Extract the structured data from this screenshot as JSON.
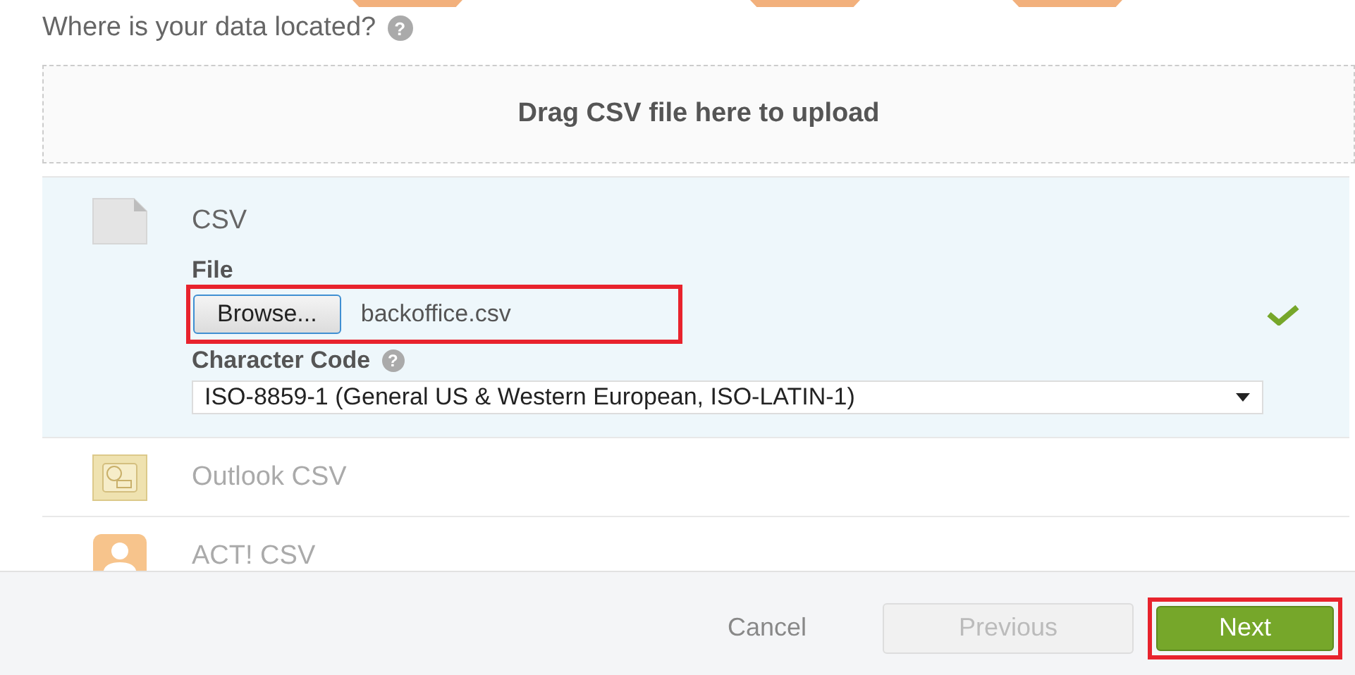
{
  "header": {
    "question": "Where is your data located?",
    "help": "?"
  },
  "dropzone": {
    "text": "Drag CSV file here to upload"
  },
  "sources": [
    {
      "kind": "csv",
      "label": "CSV",
      "selected": true,
      "file_label": "File",
      "browse": "Browse...",
      "filename": "backoffice.csv",
      "file_highlighted": true,
      "valid": true,
      "charset_label": "Character Code",
      "charset_help": "?",
      "charset": "ISO-8859-1 (General US & Western European, ISO-LATIN-1)"
    },
    {
      "kind": "outlook",
      "label": "Outlook CSV",
      "selected": false
    },
    {
      "kind": "act",
      "label": "ACT! CSV",
      "selected": false
    }
  ],
  "footer": {
    "cancel": "Cancel",
    "previous": {
      "label": "Previous",
      "disabled": true
    },
    "next": {
      "label": "Next",
      "highlighted": true
    }
  }
}
